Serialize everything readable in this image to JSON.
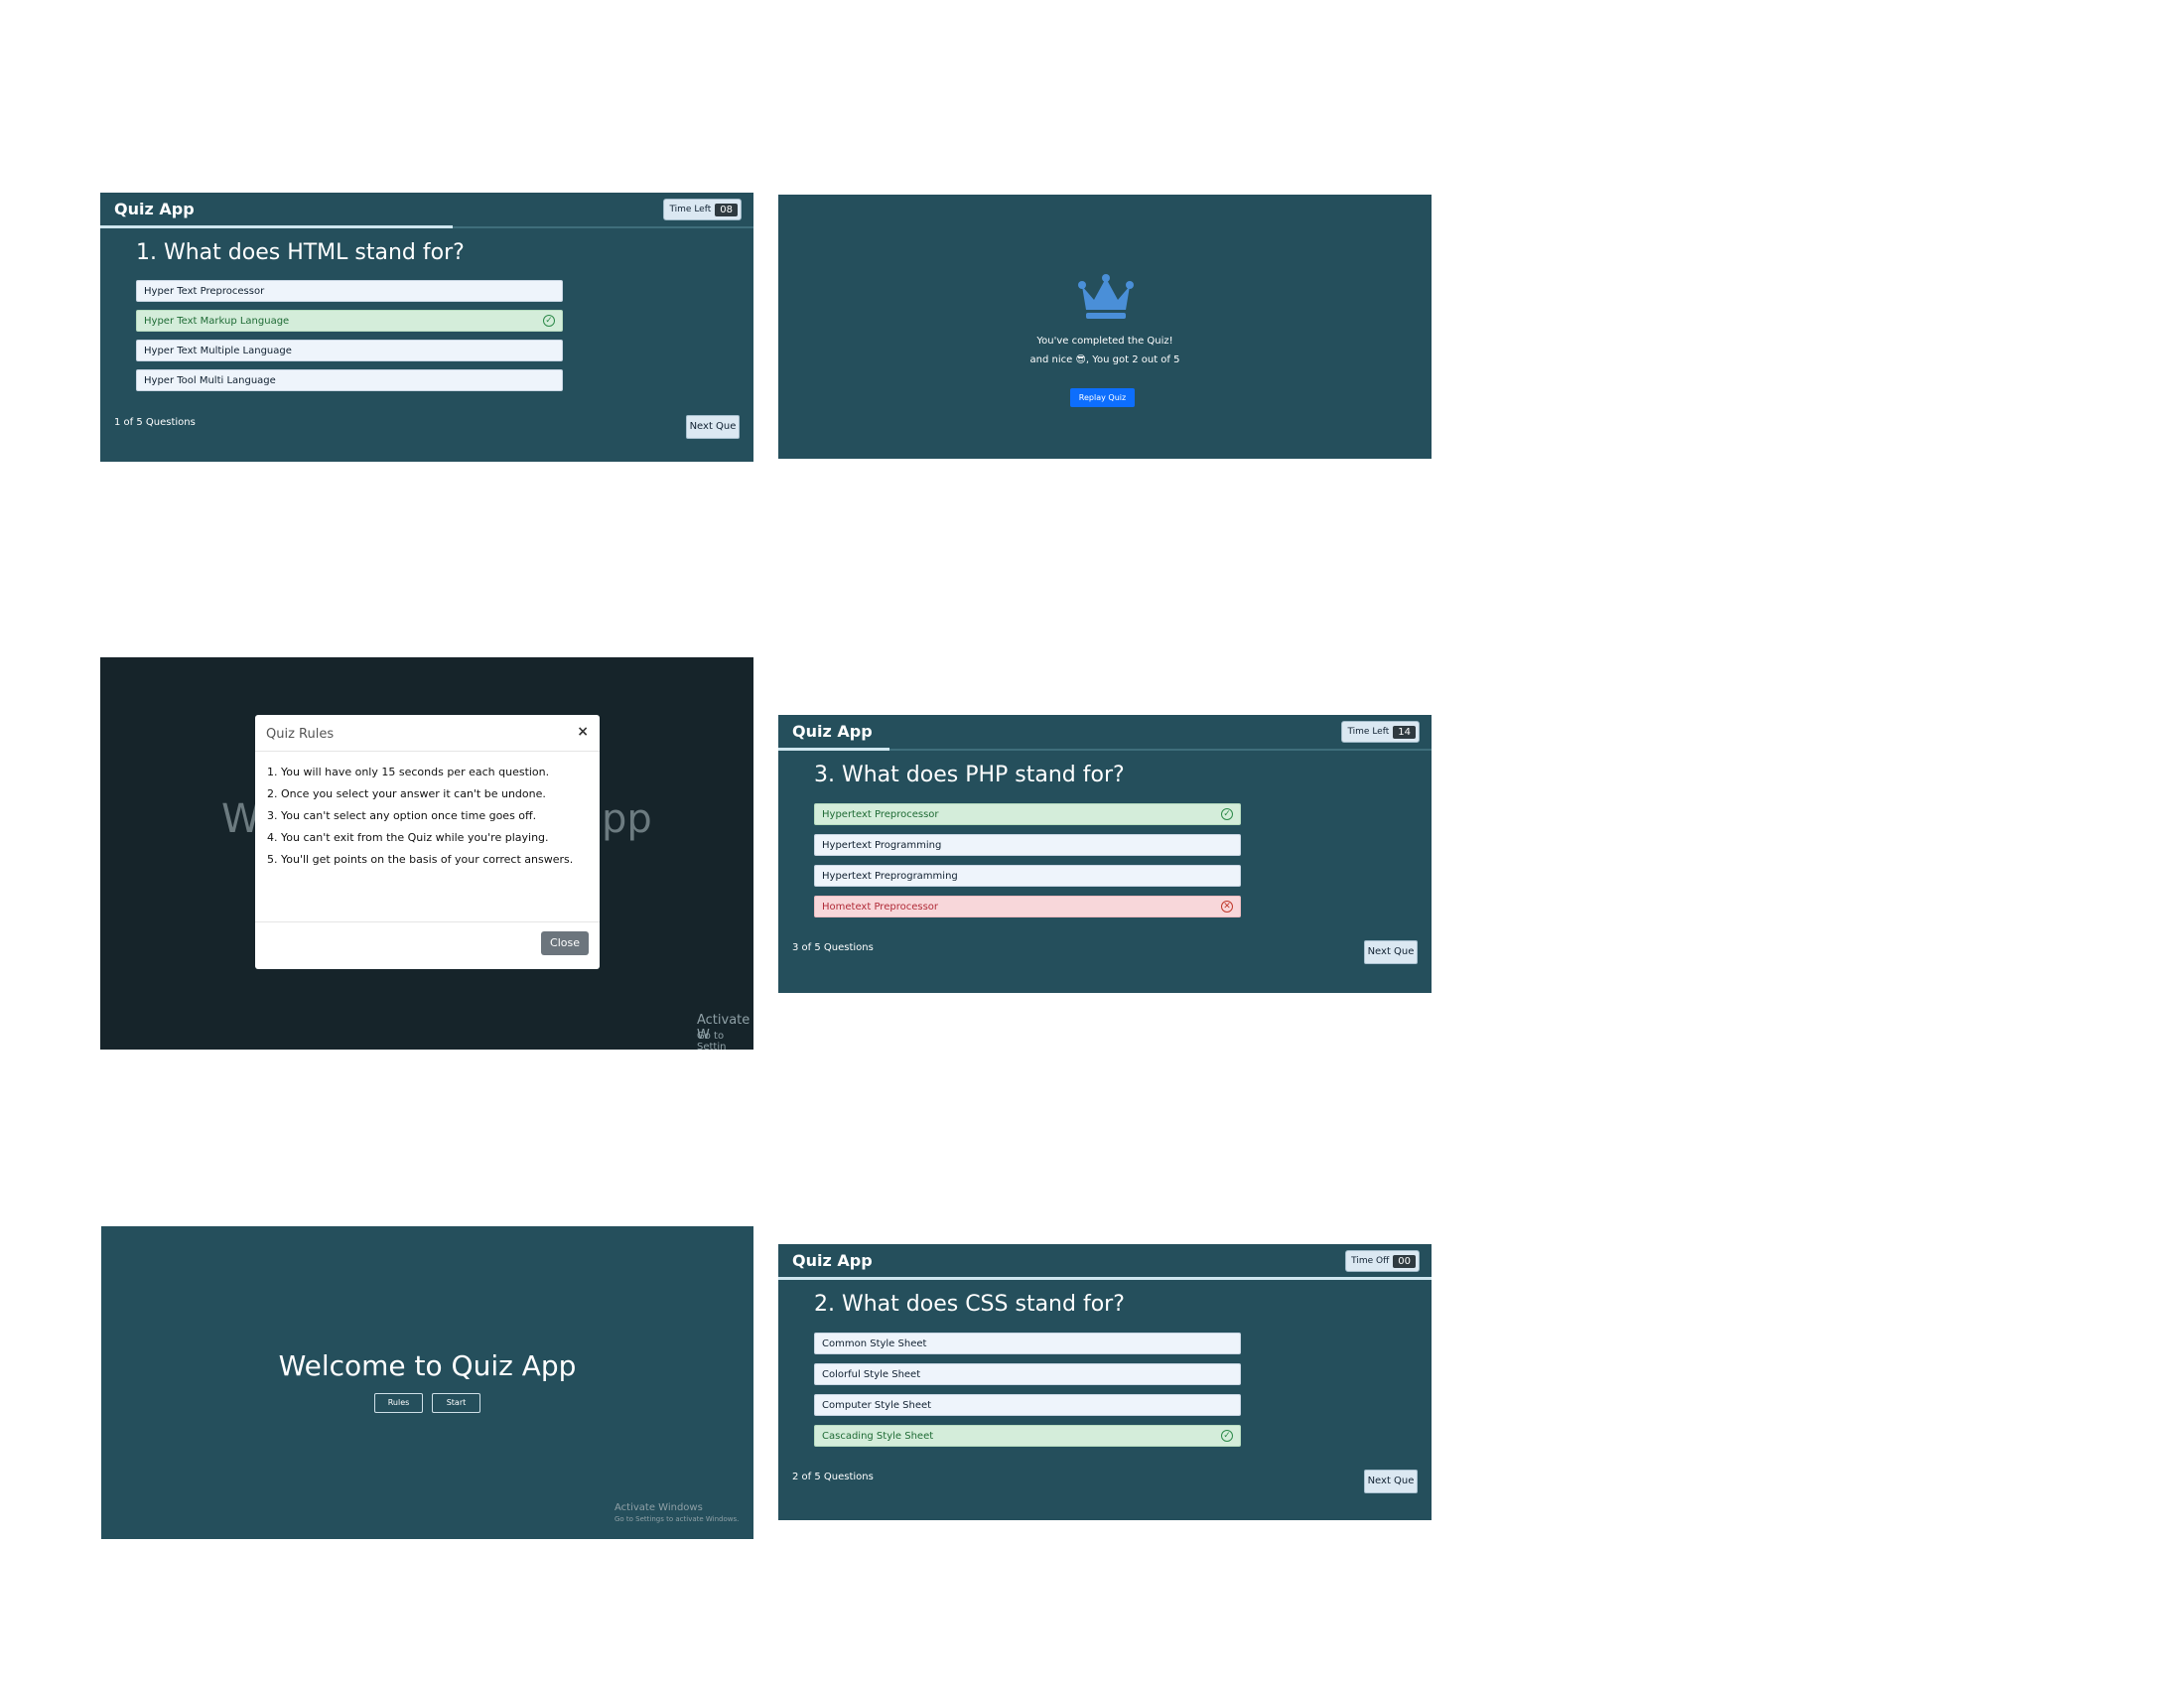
{
  "quiz1": {
    "app_title": "Quiz App",
    "timer_label": "Time Left",
    "timer_value": "08",
    "question": "1. What does HTML stand for?",
    "options": [
      {
        "text": "Hyper Text Preprocessor",
        "state": "normal"
      },
      {
        "text": "Hyper Text Markup Language",
        "state": "correct"
      },
      {
        "text": "Hyper Text Multiple Language",
        "state": "normal"
      },
      {
        "text": "Hyper Tool Multi Language",
        "state": "normal"
      }
    ],
    "count": "1 of 5 Questions",
    "next_label": "Next Que"
  },
  "result": {
    "line1": "You've completed the Quiz!",
    "line2": "and nice 😎, You got 2 out of 5",
    "replay_label": "Replay Quiz",
    "crown_color": "#4a8fd8"
  },
  "rules": {
    "bg_title_left": "W",
    "bg_title_right": "pp",
    "modal_title": "Quiz Rules",
    "close_x": "×",
    "items": [
      "You will have only 15 seconds per each question.",
      "Once you select your answer it can't be undone.",
      "You can't select any option once time goes off.",
      "You can't exit from the Quiz while you're playing.",
      "You'll get points on the basis of your correct answers."
    ],
    "close_label": "Close",
    "activate_line1": "Activate W",
    "activate_line2": "Go to Settin"
  },
  "quiz3": {
    "app_title": "Quiz App",
    "timer_label": "Time Left",
    "timer_value": "14",
    "question": "3. What does PHP stand for?",
    "options": [
      {
        "text": "Hypertext Preprocessor",
        "state": "correct"
      },
      {
        "text": "Hypertext Programming",
        "state": "normal"
      },
      {
        "text": "Hypertext Preprogramming",
        "state": "normal"
      },
      {
        "text": "Hometext Preprocessor",
        "state": "wrong"
      }
    ],
    "count": "3 of 5 Questions",
    "next_label": "Next Que"
  },
  "welcome": {
    "title": "Welcome to Quiz App",
    "rules_label": "Rules",
    "start_label": "Start",
    "activate_line1": "Activate Windows",
    "activate_line2": "Go to Settings to activate Windows."
  },
  "quiz2": {
    "app_title": "Quiz App",
    "timer_label": "Time Off",
    "timer_value": "00",
    "question": "2. What does CSS stand for?",
    "options": [
      {
        "text": "Common Style Sheet",
        "state": "normal"
      },
      {
        "text": "Colorful Style Sheet",
        "state": "normal"
      },
      {
        "text": "Computer Style Sheet",
        "state": "normal"
      },
      {
        "text": "Cascading Style Sheet",
        "state": "correct"
      }
    ],
    "count": "2 of 5 Questions",
    "next_label": "Next Que"
  },
  "colors": {
    "panel_bg": "#254f5c",
    "correct_bg": "#d4edda",
    "wrong_bg": "#f8d7da",
    "accent_button": "#0d6efd"
  }
}
